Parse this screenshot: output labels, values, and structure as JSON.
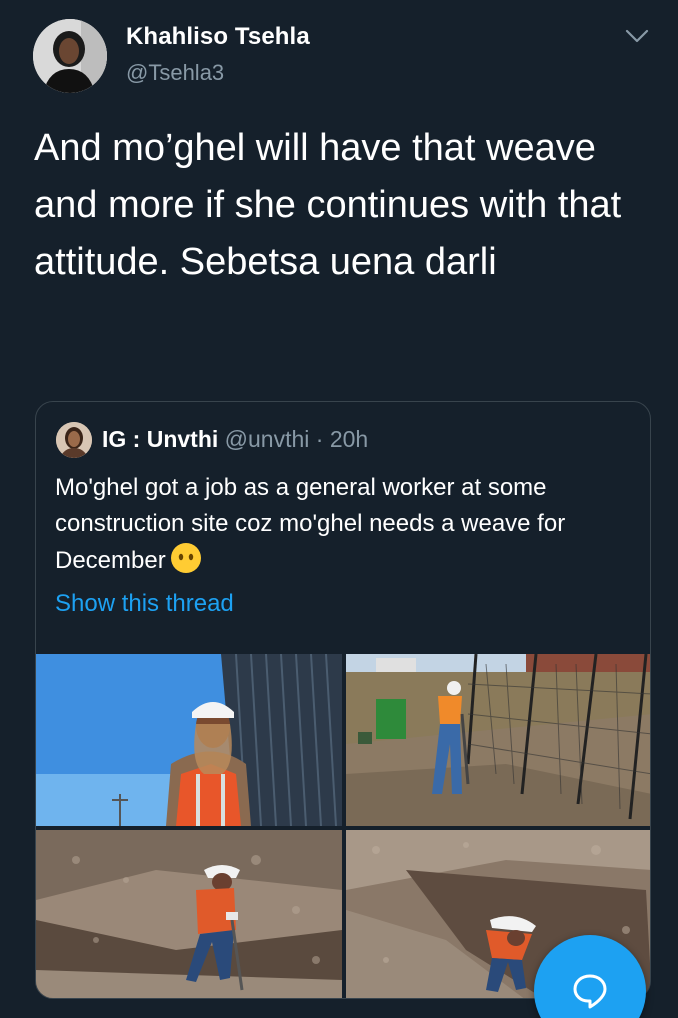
{
  "author": {
    "name": "Khahliso Tsehla",
    "handle": "@Tsehla3",
    "avatar_icon": "profile-photo"
  },
  "tweet": {
    "text": "And mo’ghel will have that weave and more if she continues with that attitude. Sebetsa uena darli"
  },
  "quoted": {
    "name": "IG : Unvthi",
    "handle": "@unvthi",
    "time": "· 20h",
    "text": "Mo'ghel got a job as a general worker at some construction site coz mo'ghel needs a weave for December",
    "emoji_icon": "face-without-mouth-emoji",
    "show_thread": "Show this thread",
    "media_count": 4
  },
  "colors": {
    "background": "#15202b",
    "text": "#ffffff",
    "secondary": "#8899a6",
    "accent": "#1da1f2",
    "border": "#38444d"
  },
  "fab": {
    "icon": "reply-bubble-icon"
  }
}
